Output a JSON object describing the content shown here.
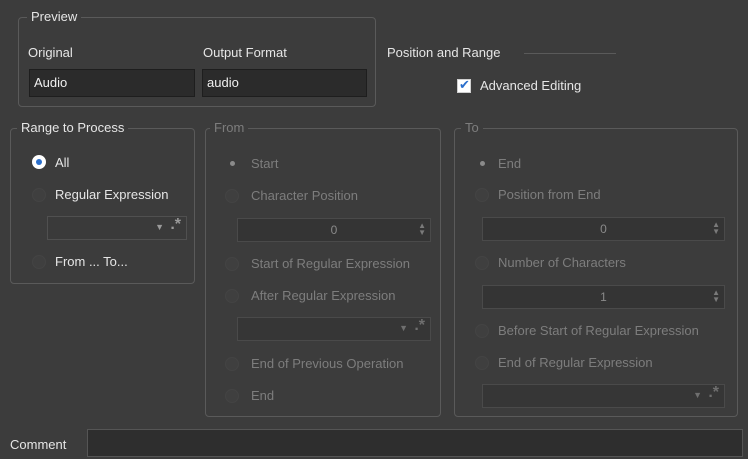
{
  "preview": {
    "title": "Preview",
    "original_label": "Original",
    "original_value": "Audio",
    "output_label": "Output Format",
    "output_value": "audio"
  },
  "position_range": {
    "title": "Position and Range",
    "advanced_editing_label": "Advanced Editing",
    "advanced_editing_checked": true
  },
  "range_to_process": {
    "title": "Range to Process",
    "all_label": "All",
    "regex_label": "Regular Expression",
    "from_to_label": "From ... To...",
    "selected": "All"
  },
  "from": {
    "title": "From",
    "start_label": "Start",
    "char_pos_label": "Character Position",
    "char_pos_value": "0",
    "start_regex_label": "Start of Regular Expression",
    "after_regex_label": "After Regular Expression",
    "end_prev_label": "End of Previous Operation",
    "end_label": "End"
  },
  "to": {
    "title": "To",
    "end_label": "End",
    "pos_from_end_label": "Position from End",
    "pos_from_end_value": "0",
    "num_chars_label": "Number of Characters",
    "num_chars_value": "1",
    "before_start_regex_label": "Before Start of Regular Expression",
    "end_regex_label": "End of Regular Expression"
  },
  "comment": {
    "label": "Comment",
    "value": ""
  },
  "icons": {
    "regex_glyph": ".*",
    "caret_glyph": "▼"
  }
}
